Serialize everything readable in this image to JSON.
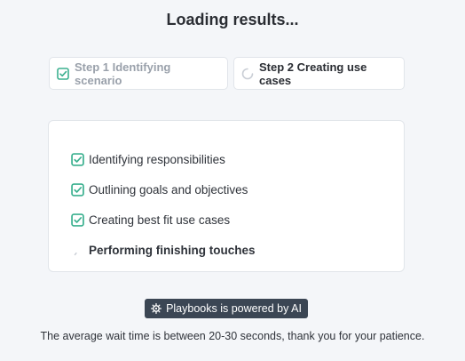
{
  "header": {
    "title": "Loading results..."
  },
  "steps": [
    {
      "label": "Step 1 Identifying scenario",
      "status": "complete",
      "icon": "check-square-icon"
    },
    {
      "label": "Step 2 Creating use cases",
      "status": "in-progress",
      "icon": "spinner-icon"
    }
  ],
  "tasks": [
    {
      "label": "Identifying responsibilities",
      "status": "complete",
      "icon": "check-square-icon"
    },
    {
      "label": "Outlining goals and objectives",
      "status": "complete",
      "icon": "check-square-icon"
    },
    {
      "label": "Creating best fit use cases",
      "status": "complete",
      "icon": "check-square-icon"
    },
    {
      "label": "Performing finishing touches",
      "status": "in-progress",
      "icon": "spinner-icon"
    }
  ],
  "badge": {
    "text": "Playbooks is powered by AI",
    "icon": "gear-icon"
  },
  "footer": {
    "note": "The average wait time is between 20-30 seconds, thank you for your patience."
  },
  "colors": {
    "background": "#f4f6f9",
    "check_green": "#3bb08f",
    "badge_bg": "#3b4654",
    "muted_text": "#9aa1ab"
  }
}
